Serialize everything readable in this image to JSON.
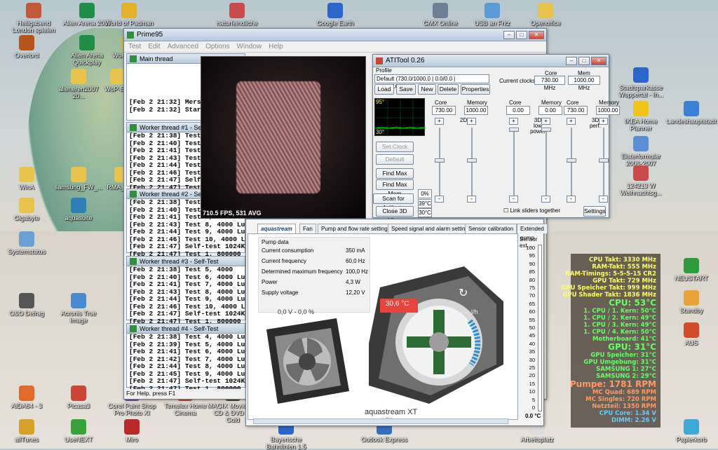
{
  "desktop_icons": [
    {
      "label": "Heiligabend London spielen",
      "x": 0
    },
    {
      "label": "Alien Arena 2007",
      "x": 0
    },
    {
      "label": "World of Padman",
      "x": 0
    },
    {
      "label": "naturfeindliche ve...",
      "x": 0
    },
    {
      "label": "Google Earth",
      "x": 0
    },
    {
      "label": "GMX Online Interaktiv",
      "x": 0
    },
    {
      "label": "USB an Fritz",
      "x": 0
    },
    {
      "label": "Openoffice",
      "x": 0
    },
    {
      "label": "Overlord",
      "x": 0
    },
    {
      "label": "Alien Arena Quickplay",
      "x": 0
    },
    {
      "label": "WoP @ R...",
      "x": 0
    },
    {
      "label": "alieneren2007 20...",
      "x": 0
    },
    {
      "label": "WoP-Edit",
      "x": 0
    },
    {
      "label": "WinA",
      "x": 0
    },
    {
      "label": "samsung_FW_...",
      "x": 0
    },
    {
      "label": "RMA_Aq...",
      "x": 0
    },
    {
      "label": "Gigabyte",
      "x": 0
    },
    {
      "label": "aquasuite",
      "x": 0
    },
    {
      "label": "Systemstatus",
      "x": 0
    },
    {
      "label": "O&O Defrag",
      "x": 0
    },
    {
      "label": "Acronis True Image",
      "x": 0
    },
    {
      "label": "AIDA64 - 3",
      "x": 0
    },
    {
      "label": "Picasa3",
      "x": 0
    },
    {
      "label": "Corel Paint Shop Pro Photo XI",
      "x": 0
    },
    {
      "label": "Temelex Home Cinema",
      "x": 0
    },
    {
      "label": "MAGIX Movies on CD & DVD 11 Gold",
      "x": 0
    },
    {
      "label": "allTunes",
      "x": 0
    },
    {
      "label": "UseNEXT",
      "x": 0
    },
    {
      "label": "Miro",
      "x": 0
    },
    {
      "label": "Bayerische Bahnlinien 1.5",
      "x": 0
    },
    {
      "label": "Outlook Express",
      "x": 0
    },
    {
      "label": "Arbeitsplatz",
      "x": 0
    },
    {
      "label": "Stadtsparkasse Wuppertal - Ih...",
      "x": 0
    },
    {
      "label": "IKEA Home Planner",
      "x": 0
    },
    {
      "label": "Landeshauptstadt",
      "x": 0
    },
    {
      "label": "Elsterformular 2006-2007",
      "x": 0
    },
    {
      "label": "124213 W Weihnachtsg...",
      "x": 0
    },
    {
      "label": "NEUSTART",
      "x": 0
    },
    {
      "label": "Standby",
      "x": 0
    },
    {
      "label": "AUS",
      "x": 0
    },
    {
      "label": "Papierkorb",
      "x": 0
    }
  ],
  "prime95": {
    "title": "Prime95",
    "menu": [
      "Test",
      "Edit",
      "Advanced",
      "Options",
      "Window",
      "Help"
    ],
    "main_thread": {
      "title": "Main thread",
      "lines": [
        "[Feb 2 21:32] Mersenne nu",
        "[Feb 2 21:32] Starting work"
      ]
    },
    "workers": [
      {
        "title": "Worker thread #1 - Self-Test",
        "lines": [
          "[Feb 2 21:38] Test 5, 4000",
          "[Feb 2 21:40] Test 6, 4000",
          "[Feb 2 21:41] Test 7, 4000",
          "[Feb 2 21:43] Test 8, 4000",
          "[Feb 2 21:44] Test 9, 4000",
          "[Feb 2 21:46] Test 10, 4000",
          "[Feb 2 21:47] Self-test 1024",
          "[Feb 2 21:47] Test 1, 8000"
        ]
      },
      {
        "title": "Worker thread #2 - Self-Test",
        "lines": [
          "[Feb 2 21:38] Test 5, 4000",
          "[Feb 2 21:40] Test 6, 4000",
          "[Feb 2 21:41] Test 7, 4000",
          "[Feb 2 21:43] Test 8, 4000 Lucas-Lehmer",
          "[Feb 2 21:44] Test 9, 4000 Lucas-Lehmer",
          "[Feb 2 21:46] Test 10, 4000 Lucas-Lehmer",
          "[Feb 2 21:47] Self-test 1024K passed!",
          "[Feb 2 21:47] Test 1, 800000 Lucas-Lehmer"
        ]
      },
      {
        "title": "Worker thread #3 - Self-Test",
        "lines": [
          "[Feb 2 21:38] Test 5, 4000",
          "[Feb 2 21:40] Test 6, 4000 Lucas-Lehmer",
          "[Feb 2 21:41] Test 7, 4000 Lucas-Lehmer",
          "[Feb 2 21:43] Test 8, 4000 Lucas-Lehmer",
          "[Feb 2 21:44] Test 9, 4000 Lucas-Lehmer",
          "[Feb 2 21:46] Test 10, 4000 Lucas-Lehmer",
          "[Feb 2 21:47] Self-test 1024K passed!",
          "[Feb 2 21:47] Test 1, 800000 Lucas-Lehmer"
        ]
      },
      {
        "title": "Worker thread #4 - Self-Test",
        "lines": [
          "[Feb 2 21:38] Test 4, 4000 Lucas-Lehmer",
          "[Feb 2 21:39] Test 5, 4000 Lucas-Lehmer",
          "[Feb 2 21:41] Test 6, 4000 Lucas-Lehmer",
          "[Feb 2 21:42] Test 7, 4000 Lucas-Lehmer",
          "[Feb 2 21:44] Test 8, 4000 Lucas-Lehmer",
          "[Feb 2 21:45] Test 9, 4000 Lucas-Lehmer",
          "[Feb 2 21:47] Self-test 1024K passed!",
          "[Feb 2 21:47] Test 1, 800000 Lucas-Lehmer"
        ]
      }
    ],
    "status": "For Help, press F1"
  },
  "render3d": {
    "fps": "710.5 FPS, 531 AVG"
  },
  "atitool": {
    "title": "ATITool 0.26",
    "profile_label": "Profile",
    "profile_value": "Default (730.0/1000.0 | 0.0/0.0 | 730.0/1000.0)",
    "buttons": [
      "Load",
      "Save",
      "New",
      "Delete",
      "Properties"
    ],
    "current_clocks_label": "Current clocks:",
    "core_label": "Core",
    "mem_label": "Mem",
    "core_value": "730.00 MHz",
    "mem_value": "1000.00 MHz",
    "temp_top": "95°",
    "temp_bottom": "30°",
    "side_buttons": [
      "Set Clock",
      "Default",
      "Find Max Core",
      "Find Max Mem",
      "Scan for Artifacts",
      "Close 3D View"
    ],
    "readouts": [
      "0%",
      "39°C",
      "30°C"
    ],
    "groups": [
      {
        "name": "2D",
        "core": "730.00",
        "memory": "1000.00"
      },
      {
        "name": "3D low power",
        "core": "0.00",
        "memory": "0.00"
      },
      {
        "name": "3D perf.",
        "core": "730.00",
        "memory": "1000.00"
      }
    ],
    "core_col": "Core",
    "memory_col": "Memory",
    "link_label": "Link sliders together",
    "settings": "Settings"
  },
  "aquasuite": {
    "tabs": [
      "aquastream",
      "Fan",
      "Pump and flow rate settings",
      "Speed signal and alarm settings",
      "Sensor calibration",
      "Extended pump"
    ],
    "pump_data_title": "Pump data",
    "rows": [
      {
        "label": "Current consumption",
        "value": "350 mA"
      },
      {
        "label": "Current frequency",
        "value": "60,0 Hz"
      },
      {
        "label": "Determined maximum frequency",
        "value": "100,0 Hz"
      },
      {
        "label": "Power",
        "value": "4,3 W"
      },
      {
        "label": "Supply voltage",
        "value": "12,20 V"
      }
    ],
    "fan_label": "0,0 V - 0,0 %",
    "pump_temp": "30,6 °C",
    "flow": "---.-- l/h",
    "product": "aquastream XT",
    "product_sub": "ultra",
    "sensor_label": "Sensor ext...",
    "scale": [
      "100",
      "95",
      "90",
      "85",
      "80",
      "75",
      "70",
      "65",
      "60",
      "55",
      "50",
      "45",
      "40",
      "35",
      "30",
      "25",
      "20",
      "15",
      "10",
      "5",
      "0"
    ],
    "scale_value": "0.0 °C"
  },
  "overlay": [
    {
      "text": "CPU Takt: 3330 MHz",
      "color": "#ffff66",
      "big": false
    },
    {
      "text": "RAM-Takt: 555 MHz",
      "color": "#ffff66",
      "big": false
    },
    {
      "text": "RAM-Timings: 5-5-5-15 CR2",
      "color": "#ffff66",
      "big": false
    },
    {
      "text": "GPU Takt: 729 MHz",
      "color": "#ffff66",
      "big": false
    },
    {
      "text": "GPU Speicher Takt: 999 MHz",
      "color": "#ffff66",
      "big": false
    },
    {
      "text": "GPU Shader Takt: 1836 MHz",
      "color": "#ffff66",
      "big": false
    },
    {
      "text": "CPU: 53°C",
      "color": "#66ff66",
      "big": true
    },
    {
      "text": "1. CPU / 1. Kern: 50°C",
      "color": "#66ff66",
      "big": false
    },
    {
      "text": "1. CPU / 2. Kern: 49°C",
      "color": "#66ff66",
      "big": false
    },
    {
      "text": "1. CPU / 3. Kern: 49°C",
      "color": "#66ff66",
      "big": false
    },
    {
      "text": "1. CPU / 4. Kern: 50°C",
      "color": "#66ff66",
      "big": false
    },
    {
      "text": "Motherboard: 41°C",
      "color": "#66ff66",
      "big": false
    },
    {
      "text": "GPU: 31°C",
      "color": "#66ff66",
      "big": true
    },
    {
      "text": "GPU Speicher: 31°C",
      "color": "#66ff66",
      "big": false
    },
    {
      "text": "GPU Umgebung: 31°C",
      "color": "#66ff66",
      "big": false
    },
    {
      "text": "SAMSUNG 1: 27°C",
      "color": "#66ff66",
      "big": false
    },
    {
      "text": "SAMSUNG 2: 29°C",
      "color": "#66ff66",
      "big": false
    },
    {
      "text": "Pumpe: 1781 RPM",
      "color": "#ff9966",
      "big": true
    },
    {
      "text": "MC Quad: 689 RPM",
      "color": "#ff9966",
      "big": false
    },
    {
      "text": "MC Singles: 720 RPM",
      "color": "#ff9966",
      "big": false
    },
    {
      "text": "Netzteil: 1350 RPM",
      "color": "#ff9966",
      "big": false
    },
    {
      "text": "CPU Core: 1.34 V",
      "color": "#66ccff",
      "big": false
    },
    {
      "text": "DIMM: 2.26 V",
      "color": "#66ccff",
      "big": false
    }
  ]
}
